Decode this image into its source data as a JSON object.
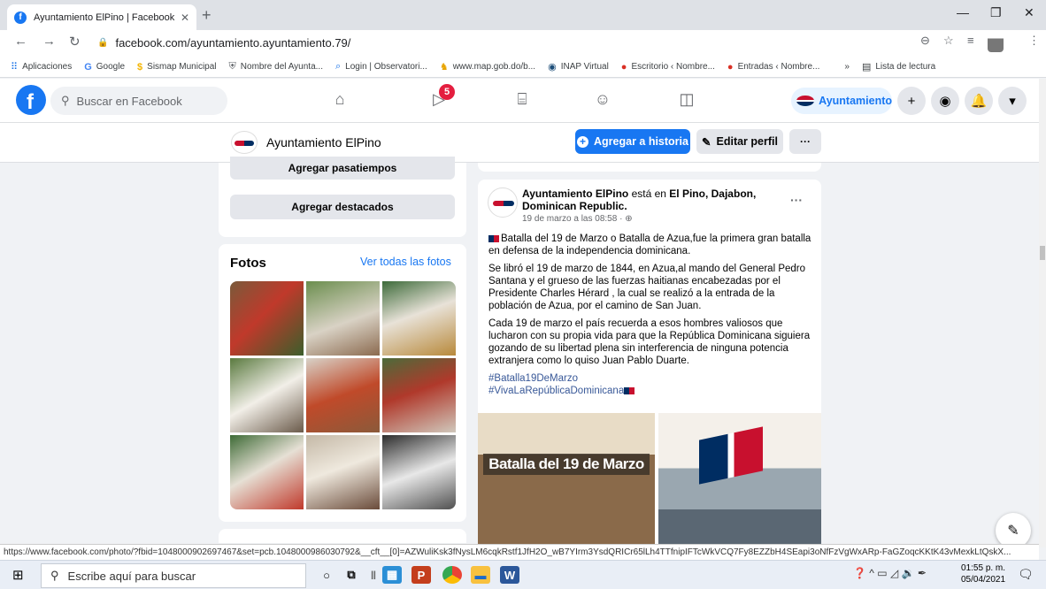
{
  "browser": {
    "tab_title": "Ayuntamiento ElPino | Facebook",
    "tab_close": "✕",
    "new_tab": "+",
    "url": "facebook.com/ayuntamiento.ayuntamiento.79/",
    "bookmarks": [
      {
        "label": "Aplicaciones",
        "icon": "apps-grid-icon"
      },
      {
        "label": "Google",
        "icon": "google-icon"
      },
      {
        "label": "Sismap Municipal",
        "icon": "sismap-icon"
      },
      {
        "label": "Nombre del Ayunta...",
        "icon": "shield-icon"
      },
      {
        "label": "Login | Observatori...",
        "icon": "search-icon"
      },
      {
        "label": "www.map.gob.do/b...",
        "icon": "map-icon"
      },
      {
        "label": "INAP Virtual",
        "icon": "inap-icon"
      },
      {
        "label": "Escritorio ‹ Nombre...",
        "icon": "wordpress-icon"
      },
      {
        "label": "Entradas ‹ Nombre...",
        "icon": "wordpress-icon"
      }
    ],
    "more_bookmarks": "»",
    "reading_list": "Lista de lectura"
  },
  "fb": {
    "search_placeholder": "Buscar en Facebook",
    "notification_count": "5",
    "profile_chip": "Ayuntamiento",
    "page_name": "Ayuntamiento ElPino",
    "add_story": "Agregar a historia",
    "edit_profile": "Editar perfil",
    "more": "···"
  },
  "left": {
    "add_hobbies": "Agregar pasatiempos",
    "add_featured": "Agregar destacados",
    "photos_title": "Fotos",
    "see_all_photos": "Ver todas las fotos"
  },
  "post": {
    "author": "Ayuntamiento ElPino",
    "is_at": "está en",
    "location": "El Pino, Dajabon, Dominican Republic.",
    "date": "19 de marzo a las 08:58 · ",
    "dots": "···",
    "p1": "Batalla del 19 de Marzo o Batalla de Azua,fue la primera gran batalla en defensa de la independencia dominicana.",
    "p2": "Se libró el 19 de marzo de 1844, en Azua,al mando del General Pedro Santana y el grueso de las fuerzas haitianas encabezadas por el Presidente Charles Hérard , la cual se realizó a la entrada de la población de Azua, por el camino de San Juan.",
    "p3": "Cada 19 de marzo el país recuerda a esos hombres valiosos que lucharon con su propia vida para que la República Dominicana siguiera gozando de su libertad plena sin interferencia de ninguna potencia extranjera como lo quiso Juan Pablo Duarte.",
    "hashtag1": "#Batalla19DeMarzo",
    "hashtag2": "#VivaLaRepúblicaDominicana",
    "image_caption": "Batalla del 19 de Marzo"
  },
  "status_url": "https://www.facebook.com/photo/?fbid=1048000902697467&set=pcb.1048000986030792&__cft__[0]=AZWuliKsk3fNysLM6cqkRstf1JfH2O_wB7YIrm3YsdQRICr65lLh4TTfnipIFTcWkVCQ7Fy8EZZbH4SEapi3oNfFzVgWxARp-FaGZoqcKKtK43vMexkLtQskX...",
  "taskbar": {
    "search_placeholder": "Escribe aquí para buscar",
    "time": "01:55 p. m.",
    "date": "05/04/2021"
  },
  "colors": {
    "fb_blue": "#1877f2",
    "badge_red": "#e41e3f"
  }
}
